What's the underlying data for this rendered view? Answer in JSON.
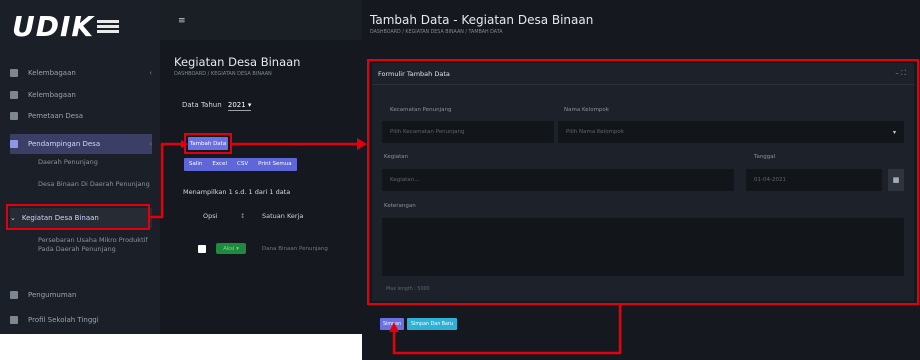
{
  "left": {
    "logo": "UDIK",
    "nav": [
      {
        "label": "Kelembagaan",
        "chevron": "‹"
      },
      {
        "label": "Kelembagaan",
        "chevron": ""
      },
      {
        "label": "Pemetaan Desa",
        "chevron": ""
      },
      {
        "label": "Pendampingan Desa",
        "chevron": "‹"
      }
    ],
    "sub_items": [
      "Daerah Penunjang",
      "Desa Binaan Di Daerah Penunjang"
    ],
    "active_item": "Kegiatan Desa Binaan",
    "sub_items2": "Persebaran Usaha Mikro Produktif Pada Daerah Penunjang",
    "nav_bottom": [
      {
        "label": "Pengumuman"
      },
      {
        "label": "Profil Sekolah Tinggi"
      }
    ],
    "topbar_icon": "≡",
    "page_title": "Kegiatan Desa Binaan",
    "breadcrumb": "DASHBOARD / KEGIATAN DESA BINAAN",
    "year_label": "Data Tahun",
    "year_value": "2021 ▾",
    "add_button": "Tambah Data",
    "export_buttons": [
      "Salin",
      "Excel",
      "CSV",
      "Print Semua"
    ],
    "showing_text": "Menampilkan 1 s.d. 1 dari 1 data",
    "col_opsi": "Opsi",
    "sort_arrow": "↕",
    "col_satuan": "Satuan Kerja",
    "row_pill": "Aksi ▾",
    "row_text": "Dana Binaan Penunjang"
  },
  "right": {
    "title": "Tambah Data - Kegiatan Desa Binaan",
    "breadcrumb": "DASHBOARD / KEGIATAN DESA BINAAN / TAMBAH DATA",
    "form_title": "Formulir Tambah Data",
    "form_controls": "– ⛶",
    "label_kecamatan": "Kecamatan Penunjang",
    "value_kecamatan": "Pilih Kecamatan Penunjang",
    "label_desa": "Nama Kelompok",
    "value_desa": "Pilih Nama Kelompok",
    "dropdown_caret": "▾",
    "label_kegiatan": "Kegiatan",
    "value_kegiatan": "Kegiatan...",
    "label_tanggal": "Tanggal",
    "value_tanggal": "01-04-2021",
    "calendar_icon": "▦",
    "label_keterangan": "Keterangan",
    "hint": "Max length : 5000",
    "save_button": "Simpan",
    "save_new_button": "Simpan Dan Baru"
  },
  "colors": {
    "highlight": "#e2000f",
    "primary": "#6a71e3",
    "info": "#2db1d6",
    "success": "#1f8a3e"
  }
}
